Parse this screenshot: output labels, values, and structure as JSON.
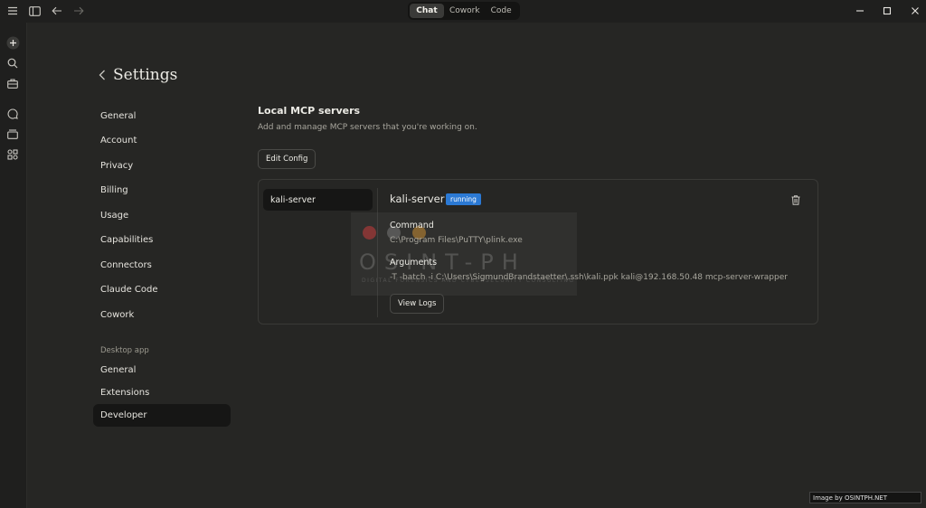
{
  "titlebar": {
    "tabs": [
      {
        "label": "Chat",
        "active": true
      },
      {
        "label": "Cowork",
        "active": false
      },
      {
        "label": "Code",
        "active": false
      }
    ]
  },
  "settings": {
    "title": "Settings",
    "nav": [
      "General",
      "Account",
      "Privacy",
      "Billing",
      "Usage",
      "Capabilities",
      "Connectors",
      "Claude Code",
      "Cowork"
    ],
    "desktop_section_label": "Desktop app",
    "desktop_nav": [
      "General",
      "Extensions",
      "Developer"
    ],
    "active_item": "Developer"
  },
  "main": {
    "heading": "Local MCP servers",
    "subheading": "Add and manage MCP servers that you're working on.",
    "edit_config_label": "Edit Config",
    "server_list": [
      "kali-server"
    ],
    "server": {
      "name": "kali-server",
      "status": "running",
      "command_label": "Command",
      "command": "C:\\Program Files\\PuTTY\\plink.exe",
      "arguments_label": "Arguments",
      "arguments": "-T -batch -i C:\\Users\\SigmundBrandstaetter\\.ssh\\kali.ppk kali@192.168.50.48 mcp-server-wrapper",
      "view_logs_label": "View Logs"
    }
  },
  "watermark": {
    "text": "OSINT-PH",
    "tagline": "DIGITAL FORENSICS AND CYBERSECURITY CONSULTING"
  },
  "credit": "Image by OSINTPH.NET",
  "colors": {
    "background": "#262624",
    "sidebar": "#1f1f1e",
    "badge": "#2b79d4"
  }
}
